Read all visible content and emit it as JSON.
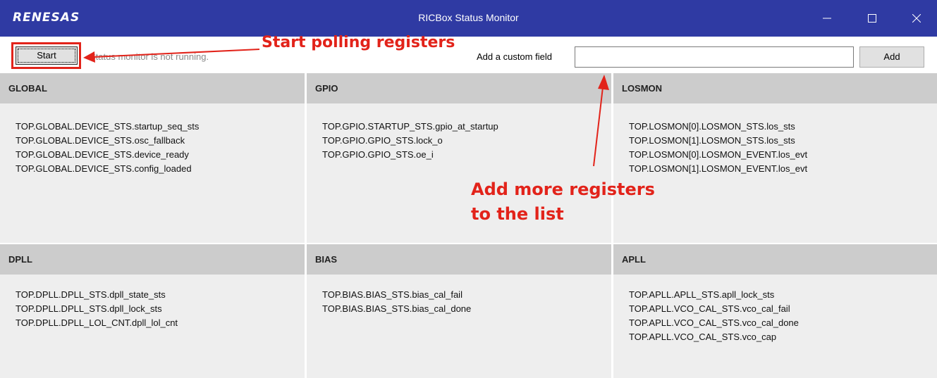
{
  "window": {
    "logo": "RENESAS",
    "title": "RICBox Status Monitor",
    "controls": [
      "minimize-icon",
      "maximize-icon",
      "close-icon"
    ]
  },
  "toolbar": {
    "start_label": "Start",
    "status_text": "Status monitor is not running.",
    "custom_field_label": "Add a custom field",
    "custom_field_value": "",
    "add_label": "Add"
  },
  "panels": [
    {
      "name": "GLOBAL",
      "fields": [
        "TOP.GLOBAL.DEVICE_STS.startup_seq_sts",
        "TOP.GLOBAL.DEVICE_STS.osc_fallback",
        "TOP.GLOBAL.DEVICE_STS.device_ready",
        "TOP.GLOBAL.DEVICE_STS.config_loaded"
      ]
    },
    {
      "name": "GPIO",
      "fields": [
        "TOP.GPIO.STARTUP_STS.gpio_at_startup",
        "TOP.GPIO.GPIO_STS.lock_o",
        "TOP.GPIO.GPIO_STS.oe_i"
      ]
    },
    {
      "name": "LOSMON",
      "fields": [
        "TOP.LOSMON[0].LOSMON_STS.los_sts",
        "TOP.LOSMON[1].LOSMON_STS.los_sts",
        "TOP.LOSMON[0].LOSMON_EVENT.los_evt",
        "TOP.LOSMON[1].LOSMON_EVENT.los_evt"
      ]
    },
    {
      "name": "DPLL",
      "fields": [
        "TOP.DPLL.DPLL_STS.dpll_state_sts",
        "TOP.DPLL.DPLL_STS.dpll_lock_sts",
        "TOP.DPLL.DPLL_LOL_CNT.dpll_lol_cnt"
      ]
    },
    {
      "name": "BIAS",
      "fields": [
        "TOP.BIAS.BIAS_STS.bias_cal_fail",
        "TOP.BIAS.BIAS_STS.bias_cal_done"
      ]
    },
    {
      "name": "APLL",
      "fields": [
        "TOP.APLL.APLL_STS.apll_lock_sts",
        "TOP.APLL.VCO_CAL_STS.vco_cal_fail",
        "TOP.APLL.VCO_CAL_STS.vco_cal_done",
        "TOP.APLL.VCO_CAL_STS.vco_cap"
      ]
    }
  ],
  "annotations": {
    "start_note": "Start polling registers",
    "add_note_line1": "Add more registers",
    "add_note_line2": "to the list"
  },
  "colors": {
    "titlebar": "#2f3aa3",
    "panel_header": "#cccccc",
    "panel_body": "#eeeeee",
    "annotation": "#e2231a"
  }
}
